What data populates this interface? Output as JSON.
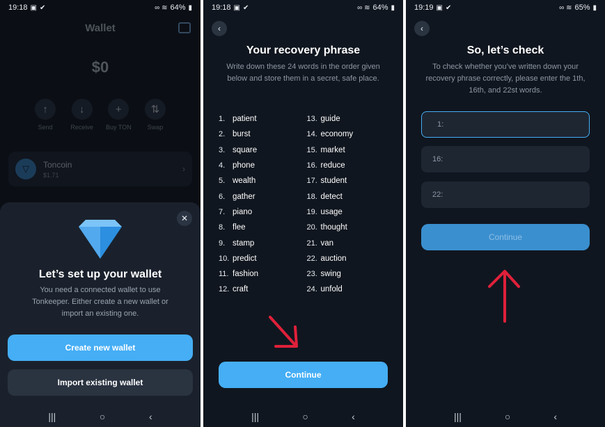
{
  "screen1": {
    "status": {
      "time": "19:18",
      "battery": "64%"
    },
    "title": "Wallet",
    "balance": "$0",
    "actions": [
      "Send",
      "Receive",
      "Buy TON",
      "Swap"
    ],
    "token": {
      "name": "Toncoin",
      "price": "$1.71"
    },
    "sheet": {
      "title": "Let’s set up your wallet",
      "description": "You need a connected wallet to use Tonkeeper. Either create a new wallet or import an existing one.",
      "create_label": "Create new wallet",
      "import_label": "Import existing wallet"
    }
  },
  "screen2": {
    "status": {
      "time": "19:18",
      "battery": "64%"
    },
    "title": "Your recovery phrase",
    "description": "Write down these 24 words in the order given below and store them in a secret, safe place.",
    "words": [
      {
        "n": "1.",
        "w": "patient"
      },
      {
        "n": "2.",
        "w": "burst"
      },
      {
        "n": "3.",
        "w": "square"
      },
      {
        "n": "4.",
        "w": "phone"
      },
      {
        "n": "5.",
        "w": "wealth"
      },
      {
        "n": "6.",
        "w": "gather"
      },
      {
        "n": "7.",
        "w": "piano"
      },
      {
        "n": "8.",
        "w": "flee"
      },
      {
        "n": "9.",
        "w": "stamp"
      },
      {
        "n": "10.",
        "w": "predict"
      },
      {
        "n": "11.",
        "w": "fashion"
      },
      {
        "n": "12.",
        "w": "craft"
      },
      {
        "n": "13.",
        "w": "guide"
      },
      {
        "n": "14.",
        "w": "economy"
      },
      {
        "n": "15.",
        "w": "market"
      },
      {
        "n": "16.",
        "w": "reduce"
      },
      {
        "n": "17.",
        "w": "student"
      },
      {
        "n": "18.",
        "w": "detect"
      },
      {
        "n": "19.",
        "w": "usage"
      },
      {
        "n": "20.",
        "w": "thought"
      },
      {
        "n": "21.",
        "w": "van"
      },
      {
        "n": "22.",
        "w": "auction"
      },
      {
        "n": "23.",
        "w": "swing"
      },
      {
        "n": "24.",
        "w": "unfold"
      }
    ],
    "continue_label": "Continue"
  },
  "screen3": {
    "status": {
      "time": "19:19",
      "battery": "65%"
    },
    "title": "So, let’s check",
    "description": "To check whether you’ve written down your recovery phrase correctly, please enter the 1th, 16th, and  22st words.",
    "fields": [
      "1:",
      "16:",
      "22:"
    ],
    "continue_label": "Continue"
  },
  "colors": {
    "accent": "#45aef5",
    "background": "#10161f",
    "arrow": "#e0203a"
  }
}
